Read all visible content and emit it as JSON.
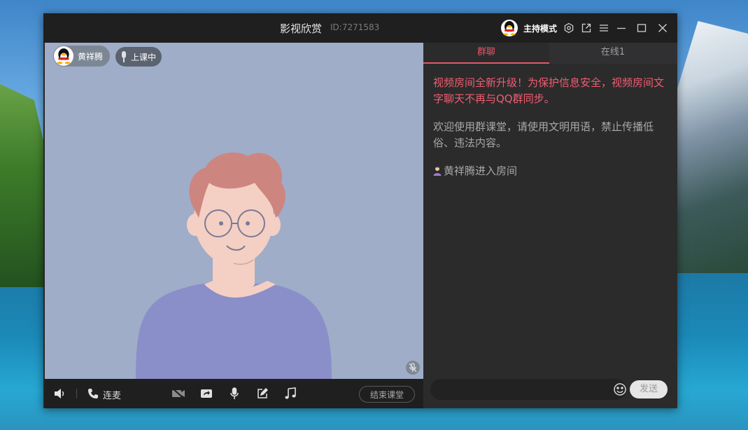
{
  "window": {
    "title": "影视欣赏",
    "room_id": "ID:7271583",
    "host_mode_label": "主持模式"
  },
  "video": {
    "user_name": "黄祥腾",
    "status_label": "上课中"
  },
  "toolbar": {
    "connect_label": "连麦",
    "end_class_label": "结束课堂"
  },
  "chat": {
    "tabs": [
      {
        "label": "群聊",
        "active": true
      },
      {
        "label": "在线1",
        "active": false
      }
    ],
    "notice_text": "视频房间全新升级！为保护信息安全，视频房间文字聊天不再与QQ群同步。",
    "rules_text": "欢迎使用群课堂，请使用文明用语，禁止传播低俗、违法内容。",
    "join_user": "黄祥腾",
    "join_text": " 进入房间",
    "send_label": "发送",
    "input_value": ""
  },
  "colors": {
    "accent": "#e5566b",
    "notice": "#f25c70",
    "video_bg": "#9fadc8"
  },
  "icons": [
    "qq-avatar-icon",
    "settings-icon",
    "popout-icon",
    "menu-icon",
    "minimize-icon",
    "maximize-icon",
    "close-icon",
    "mic-icon",
    "speaker-icon",
    "phone-icon",
    "camera-off-icon",
    "share-screen-icon",
    "microphone-icon",
    "edit-icon",
    "music-icon",
    "emoji-icon",
    "user-icon"
  ]
}
